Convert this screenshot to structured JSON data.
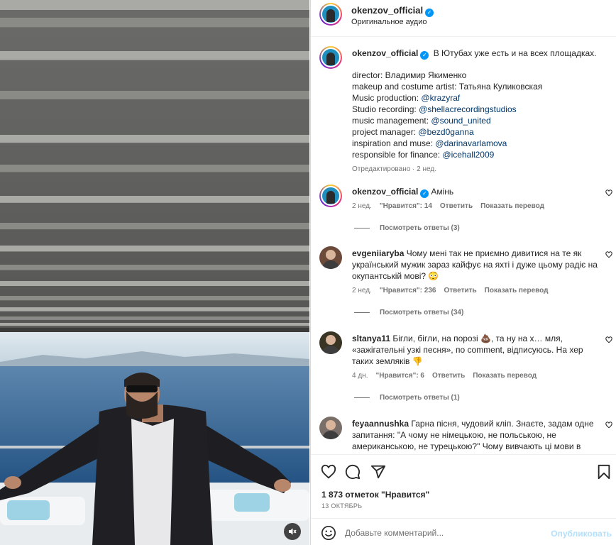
{
  "header": {
    "username": "okenzov_official",
    "subtitle": "Оригинальное аудио"
  },
  "caption": {
    "username": "okenzov_official",
    "first_line": "В Ютубах уже есть и на всех площадках.",
    "lines": [
      {
        "label": "director: Владимир Якименко",
        "link": ""
      },
      {
        "label": "makeup and costume artist: Татьяна Куликовская",
        "link": ""
      },
      {
        "label": "Music production: ",
        "link": "@krazyraf"
      },
      {
        "label": "Studio recording: ",
        "link": "@shellacrecordingstudios"
      },
      {
        "label": "music management: ",
        "link": "@sound_united"
      },
      {
        "label": "project manager: ",
        "link": "@bezd0ganna"
      },
      {
        "label": "inspiration and muse: ",
        "link": "@darinavarlamova"
      },
      {
        "label": "responsible for finance: ",
        "link": "@icehall2009"
      }
    ],
    "edited": "Отредактировано · 2 нед."
  },
  "comments": [
    {
      "username": "okenzov_official",
      "text": "Амінь",
      "time": "2 нед.",
      "likes": "\"Нравится\": 14",
      "reply": "Ответить",
      "translate": "Показать перевод",
      "view_replies": "Посмотреть ответы (3)"
    },
    {
      "username": "evgeniiaryba",
      "text": "Чому мені так не приємно дивитися на те як український мужик зараз кайфує на яхті і дуже цьому радіє на окупантській мові? 😳",
      "time": "2 нед.",
      "likes": "\"Нравится\": 236",
      "reply": "Ответить",
      "translate": "Показать перевод",
      "view_replies": "Посмотреть ответы (34)"
    },
    {
      "username": "sltanya11",
      "text": "Бігли, бігли, на порозі 💩, та ну на х… мля, «зажігательні узкі песня», по comment, відписуюсь. На хер таких земляків 👎",
      "time": "4 дн.",
      "likes": "\"Нравится\": 6",
      "reply": "Ответить",
      "translate": "Показать перевод",
      "view_replies": "Посмотреть ответы (1)"
    },
    {
      "username": "feyaannushka",
      "text": "Гарна пісня, чудовий кліп. Знаєте, задам одне запитання: \"А чому не німецькою, не польською, не американською, не турецькою?\" Чому вивчають ці мови в",
      "time": "",
      "likes": "",
      "reply": "",
      "translate": "",
      "view_replies": ""
    }
  ],
  "footer": {
    "likes": "1 873 отметок \"Нравится\"",
    "date": "13 ОКТЯБРЬ",
    "comment_placeholder": "Добавьте комментарий...",
    "publish": "Опубликовать"
  },
  "icons": {
    "like": "heart-icon",
    "comment": "comment-icon",
    "share": "share-icon",
    "save": "bookmark-icon",
    "emoji": "emoji-icon",
    "mute": "muted-speaker-icon"
  },
  "colors": {
    "link": "#00376b",
    "verified": "#0095f6",
    "publish": "#b2dffc"
  }
}
